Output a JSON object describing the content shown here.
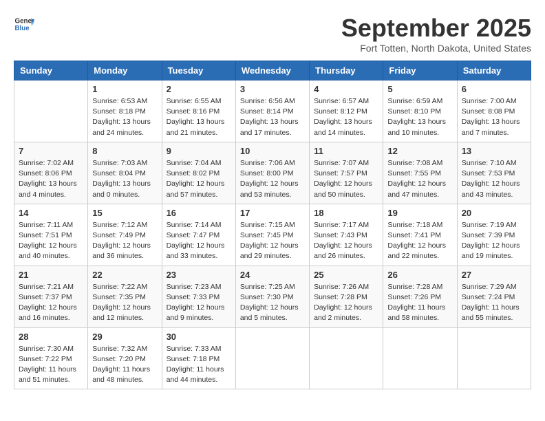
{
  "logo": {
    "general": "General",
    "blue": "Blue"
  },
  "header": {
    "month": "September 2025",
    "location": "Fort Totten, North Dakota, United States"
  },
  "days_of_week": [
    "Sunday",
    "Monday",
    "Tuesday",
    "Wednesday",
    "Thursday",
    "Friday",
    "Saturday"
  ],
  "weeks": [
    [
      {
        "day": "",
        "info": ""
      },
      {
        "day": "1",
        "info": "Sunrise: 6:53 AM\nSunset: 8:18 PM\nDaylight: 13 hours\nand 24 minutes."
      },
      {
        "day": "2",
        "info": "Sunrise: 6:55 AM\nSunset: 8:16 PM\nDaylight: 13 hours\nand 21 minutes."
      },
      {
        "day": "3",
        "info": "Sunrise: 6:56 AM\nSunset: 8:14 PM\nDaylight: 13 hours\nand 17 minutes."
      },
      {
        "day": "4",
        "info": "Sunrise: 6:57 AM\nSunset: 8:12 PM\nDaylight: 13 hours\nand 14 minutes."
      },
      {
        "day": "5",
        "info": "Sunrise: 6:59 AM\nSunset: 8:10 PM\nDaylight: 13 hours\nand 10 minutes."
      },
      {
        "day": "6",
        "info": "Sunrise: 7:00 AM\nSunset: 8:08 PM\nDaylight: 13 hours\nand 7 minutes."
      }
    ],
    [
      {
        "day": "7",
        "info": "Sunrise: 7:02 AM\nSunset: 8:06 PM\nDaylight: 13 hours\nand 4 minutes."
      },
      {
        "day": "8",
        "info": "Sunrise: 7:03 AM\nSunset: 8:04 PM\nDaylight: 13 hours\nand 0 minutes."
      },
      {
        "day": "9",
        "info": "Sunrise: 7:04 AM\nSunset: 8:02 PM\nDaylight: 12 hours\nand 57 minutes."
      },
      {
        "day": "10",
        "info": "Sunrise: 7:06 AM\nSunset: 8:00 PM\nDaylight: 12 hours\nand 53 minutes."
      },
      {
        "day": "11",
        "info": "Sunrise: 7:07 AM\nSunset: 7:57 PM\nDaylight: 12 hours\nand 50 minutes."
      },
      {
        "day": "12",
        "info": "Sunrise: 7:08 AM\nSunset: 7:55 PM\nDaylight: 12 hours\nand 47 minutes."
      },
      {
        "day": "13",
        "info": "Sunrise: 7:10 AM\nSunset: 7:53 PM\nDaylight: 12 hours\nand 43 minutes."
      }
    ],
    [
      {
        "day": "14",
        "info": "Sunrise: 7:11 AM\nSunset: 7:51 PM\nDaylight: 12 hours\nand 40 minutes."
      },
      {
        "day": "15",
        "info": "Sunrise: 7:12 AM\nSunset: 7:49 PM\nDaylight: 12 hours\nand 36 minutes."
      },
      {
        "day": "16",
        "info": "Sunrise: 7:14 AM\nSunset: 7:47 PM\nDaylight: 12 hours\nand 33 minutes."
      },
      {
        "day": "17",
        "info": "Sunrise: 7:15 AM\nSunset: 7:45 PM\nDaylight: 12 hours\nand 29 minutes."
      },
      {
        "day": "18",
        "info": "Sunrise: 7:17 AM\nSunset: 7:43 PM\nDaylight: 12 hours\nand 26 minutes."
      },
      {
        "day": "19",
        "info": "Sunrise: 7:18 AM\nSunset: 7:41 PM\nDaylight: 12 hours\nand 22 minutes."
      },
      {
        "day": "20",
        "info": "Sunrise: 7:19 AM\nSunset: 7:39 PM\nDaylight: 12 hours\nand 19 minutes."
      }
    ],
    [
      {
        "day": "21",
        "info": "Sunrise: 7:21 AM\nSunset: 7:37 PM\nDaylight: 12 hours\nand 16 minutes."
      },
      {
        "day": "22",
        "info": "Sunrise: 7:22 AM\nSunset: 7:35 PM\nDaylight: 12 hours\nand 12 minutes."
      },
      {
        "day": "23",
        "info": "Sunrise: 7:23 AM\nSunset: 7:33 PM\nDaylight: 12 hours\nand 9 minutes."
      },
      {
        "day": "24",
        "info": "Sunrise: 7:25 AM\nSunset: 7:30 PM\nDaylight: 12 hours\nand 5 minutes."
      },
      {
        "day": "25",
        "info": "Sunrise: 7:26 AM\nSunset: 7:28 PM\nDaylight: 12 hours\nand 2 minutes."
      },
      {
        "day": "26",
        "info": "Sunrise: 7:28 AM\nSunset: 7:26 PM\nDaylight: 11 hours\nand 58 minutes."
      },
      {
        "day": "27",
        "info": "Sunrise: 7:29 AM\nSunset: 7:24 PM\nDaylight: 11 hours\nand 55 minutes."
      }
    ],
    [
      {
        "day": "28",
        "info": "Sunrise: 7:30 AM\nSunset: 7:22 PM\nDaylight: 11 hours\nand 51 minutes."
      },
      {
        "day": "29",
        "info": "Sunrise: 7:32 AM\nSunset: 7:20 PM\nDaylight: 11 hours\nand 48 minutes."
      },
      {
        "day": "30",
        "info": "Sunrise: 7:33 AM\nSunset: 7:18 PM\nDaylight: 11 hours\nand 44 minutes."
      },
      {
        "day": "",
        "info": ""
      },
      {
        "day": "",
        "info": ""
      },
      {
        "day": "",
        "info": ""
      },
      {
        "day": "",
        "info": ""
      }
    ]
  ]
}
